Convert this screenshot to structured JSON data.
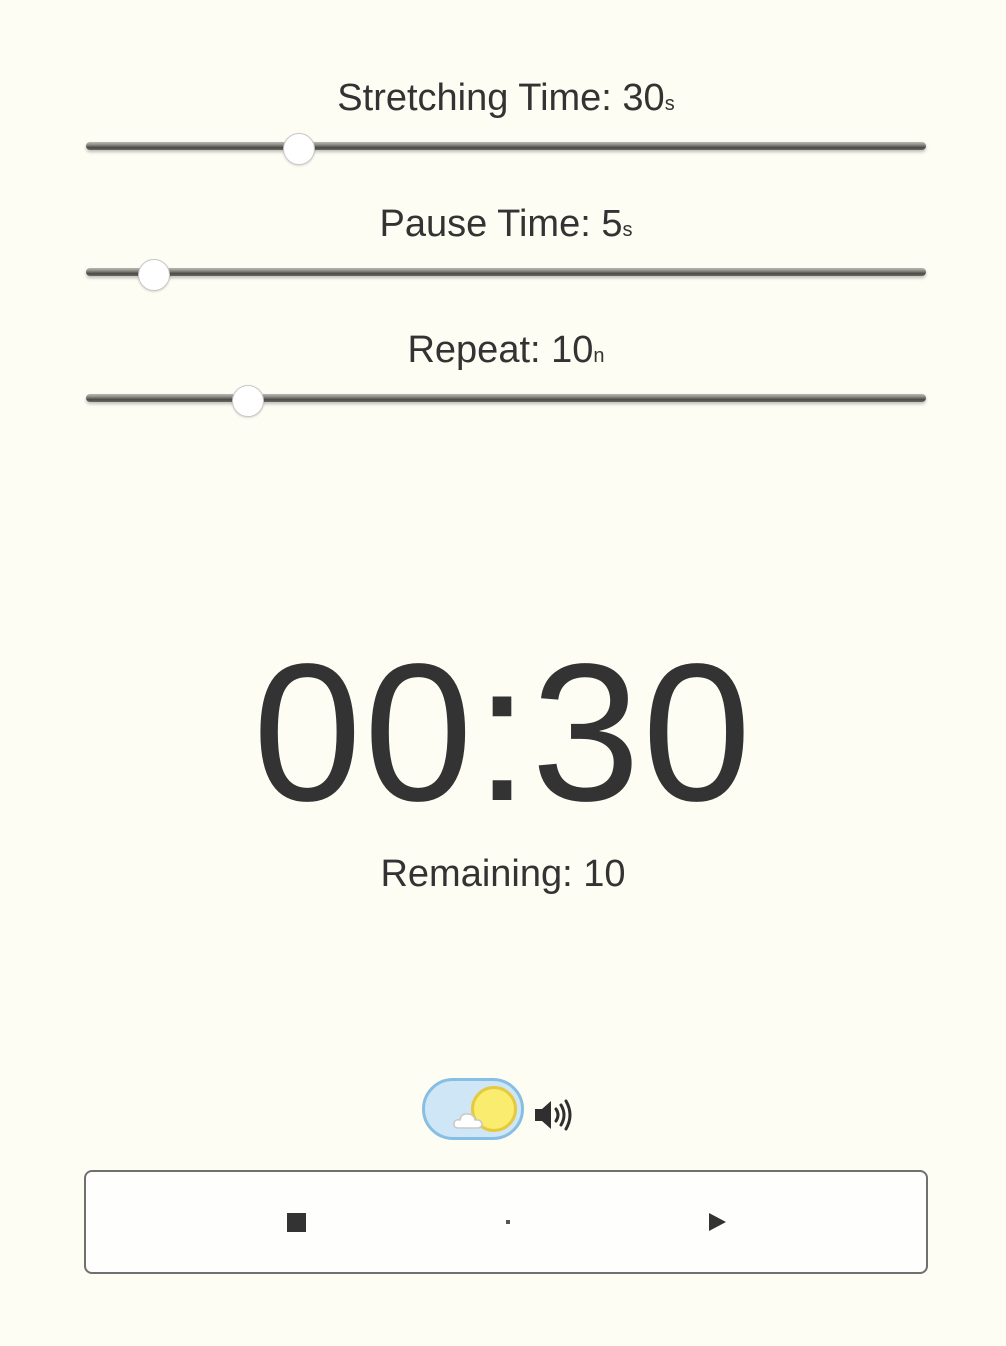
{
  "sliders": [
    {
      "label": "Stretching Time: 30",
      "unit": "s",
      "value": 30
    },
    {
      "label": "Pause Time: 5",
      "unit": "s",
      "value": 5
    },
    {
      "label": "Repeat: 10",
      "unit": "n",
      "value": 10
    }
  ],
  "timer": {
    "display": "00:30",
    "remaining_label": "Remaining: 10"
  },
  "theme_toggle": {
    "mode": "light",
    "icons": [
      "sun-icon",
      "cloud-icon"
    ],
    "colors": {
      "track": "#cfe6f6",
      "border": "#86bfe3",
      "sun": "#f9ec6e"
    }
  },
  "sound": {
    "icon": "speaker-volume-icon",
    "enabled": true
  },
  "controls": {
    "buttons": [
      "stop-icon",
      "dot-icon",
      "play-icon"
    ]
  },
  "colors": {
    "background": "#fdfdf4",
    "text": "#333333"
  }
}
